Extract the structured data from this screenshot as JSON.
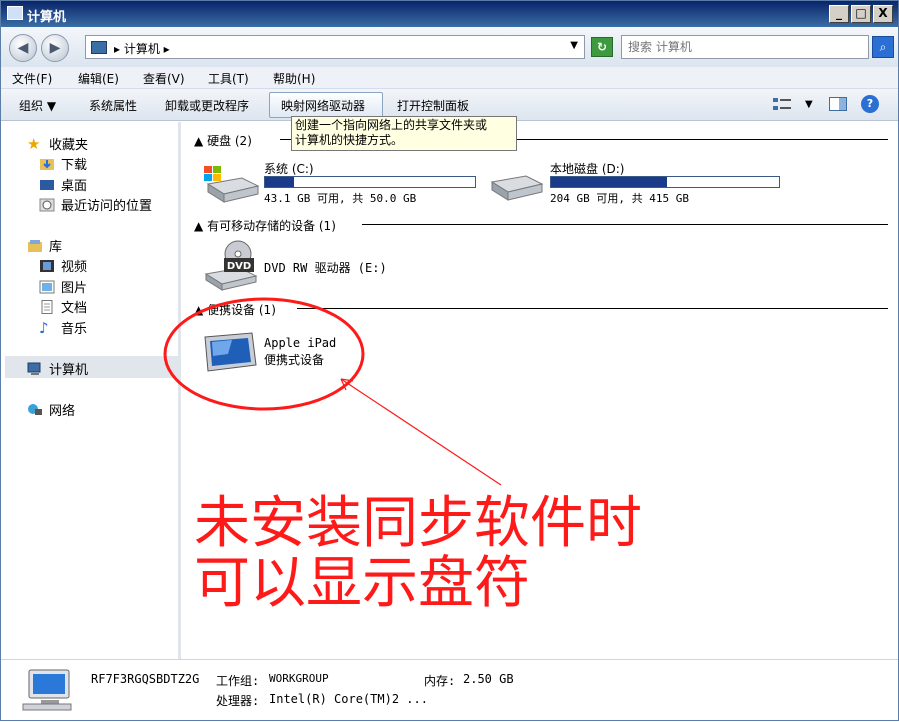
{
  "window": {
    "title": "计算机",
    "minimize": "_",
    "maximize": "□",
    "close": "X"
  },
  "address": {
    "path": "计算机",
    "search_placeholder": "搜索 计算机",
    "back_icon": "back-arrow-icon",
    "forward_icon": "forward-arrow-icon"
  },
  "menu": [
    "文件(F)",
    "编辑(E)",
    "查看(V)",
    "工具(T)",
    "帮助(H)"
  ],
  "toolbar": {
    "organize": "组织",
    "system_props": "系统属性",
    "uninstall": "卸载或更改程序",
    "map_drive": "映射网络驱动器",
    "control_panel": "打开控制面板",
    "help": "?"
  },
  "tooltip": {
    "line1": "创建一个指向网络上的共享文件夹或",
    "line2": "计算机的快捷方式。"
  },
  "sidebar": {
    "favorites": "收藏夹",
    "downloads": "下载",
    "desktop": "桌面",
    "recent": "最近访问的位置",
    "libraries": "库",
    "videos": "视频",
    "pictures": "图片",
    "documents": "文档",
    "music": "音乐",
    "computer": "计算机",
    "network": "网络"
  },
  "groups": {
    "hdd": "硬盘 (2)",
    "removable": "有可移动存储的设备 (1)",
    "portable": "便携设备 (1)"
  },
  "drives": [
    {
      "name": "系统 (C:)",
      "info": "43.1 GB 可用, 共 50.0 GB",
      "used_fraction": 0.138
    },
    {
      "name": "本地磁盘 (D:)",
      "info": "204 GB 可用, 共 415 GB",
      "used_fraction": 0.508
    }
  ],
  "dvd": {
    "name": "DVD RW 驱动器 (E:)",
    "label": "DVD"
  },
  "ipad": {
    "name": "Apple iPad",
    "type": "便携式设备"
  },
  "annotation": {
    "line1": "未安装同步软件时",
    "line2": "可以显示盘符",
    "color": "#ff1a1a"
  },
  "status": {
    "computer_name": "RF7F3RGQSBDTZ2G",
    "workgroup_label": "工作组:",
    "workgroup": "WORKGROUP",
    "memory_label": "内存:",
    "memory": "2.50 GB",
    "cpu_label": "处理器:",
    "cpu": "Intel(R) Core(TM)2 ..."
  }
}
